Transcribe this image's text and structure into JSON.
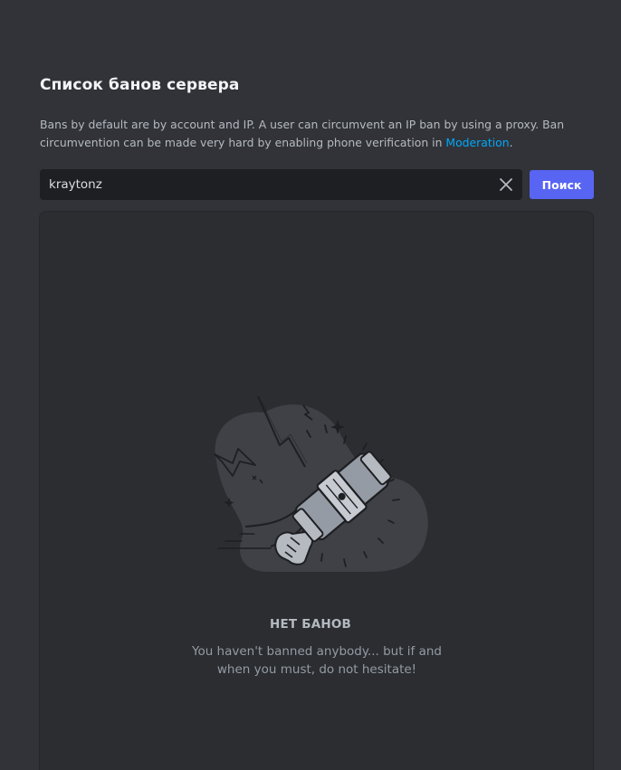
{
  "header": {
    "title": "Список банов сервера"
  },
  "description": {
    "text": "Bans by default are by account and IP. A user can circumvent an IP ban by using a proxy. Ban circumvention can be made very hard by enabling phone verification in ",
    "link_label": "Moderation",
    "suffix": "."
  },
  "search": {
    "value": "kraytonz",
    "clear_icon": "close-icon",
    "button_label": "Поиск"
  },
  "empty_state": {
    "illustration": "ban-hammer-icon",
    "title": "НЕТ БАНОВ",
    "message": "You haven't banned anybody... but if and when you must, do not hesitate!"
  },
  "colors": {
    "background": "#313338",
    "panel": "#2b2d31",
    "input": "#1e1f22",
    "accent": "#5865f2",
    "link": "#00a8fc"
  }
}
